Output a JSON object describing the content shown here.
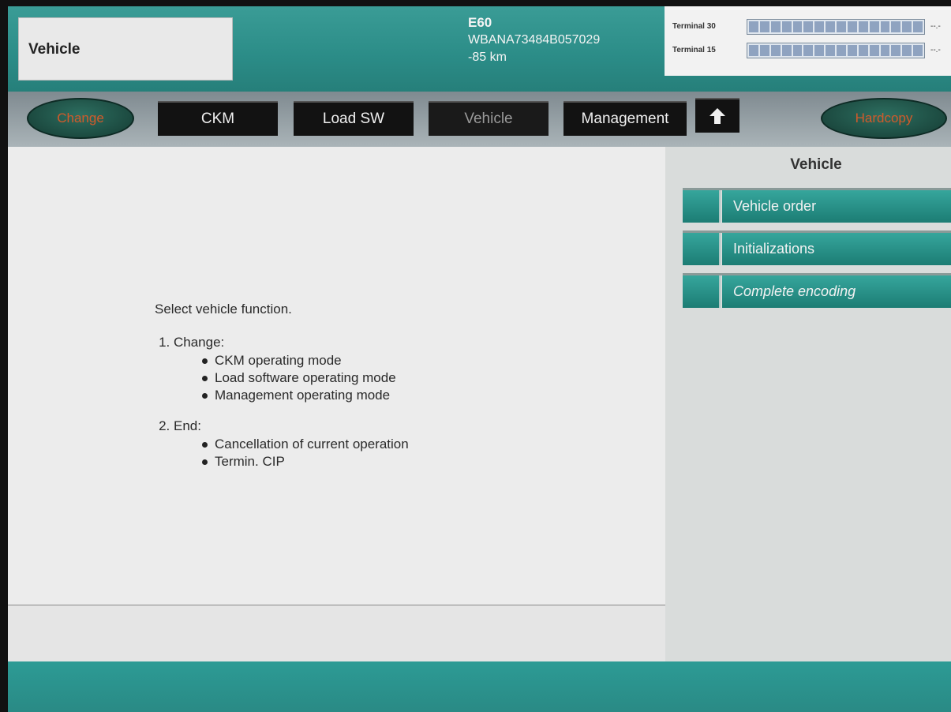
{
  "header": {
    "title": "Vehicle",
    "model": "E60",
    "vin": "WBANA73484B057029",
    "mileage": "-85 km",
    "terminals": [
      {
        "label": "Terminal 30",
        "value": "--.-"
      },
      {
        "label": "Terminal 15",
        "value": "--.-"
      }
    ]
  },
  "toolbar": {
    "change_label": "Change",
    "tabs": [
      "CKM",
      "Load SW",
      "Vehicle",
      "Management"
    ],
    "hardcopy_label": "Hardcopy",
    "up_icon": "arrow-up-icon"
  },
  "main": {
    "lead": "Select vehicle function.",
    "sections": [
      {
        "title": "Change:",
        "items": [
          "CKM operating mode",
          "Load software operating mode",
          "Management operating mode"
        ]
      },
      {
        "title": "End:",
        "items": [
          "Cancellation of current operation",
          "Termin. CIP"
        ]
      }
    ]
  },
  "sidebar": {
    "title": "Vehicle",
    "items": [
      "Vehicle order",
      "Initializations",
      "Complete encoding"
    ]
  },
  "colors": {
    "teal": "#2a8a86",
    "accent_orange": "#d25a2a",
    "tab_black": "#121212"
  }
}
